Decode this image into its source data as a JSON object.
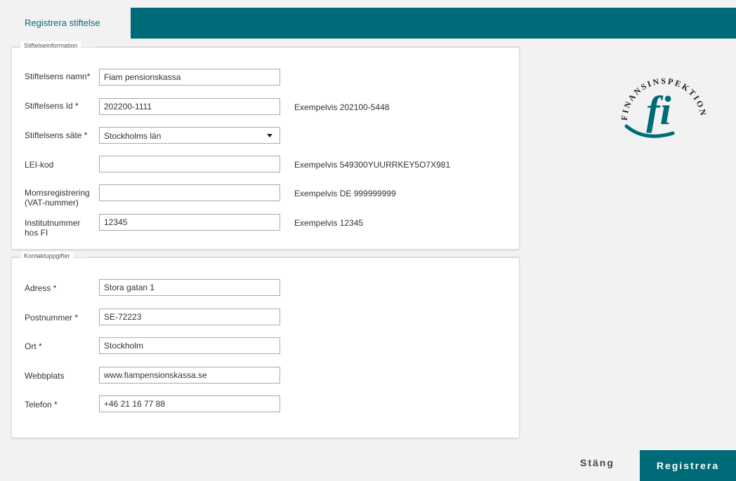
{
  "header": {
    "tab_label": "Registrera stiftelse"
  },
  "foundation_info": {
    "legend": "Stiftelseinformation",
    "name": {
      "label": "Stiftelsens namn*",
      "value": "Fiam pensionskassa"
    },
    "id": {
      "label": "Stiftelsens Id *",
      "value": "202200-1111",
      "hint": "Exempelvis 202100-5448"
    },
    "seat": {
      "label": "Stiftelsens säte *",
      "value": "Stockholms län"
    },
    "lei": {
      "label": "LEI-kod",
      "value": "",
      "hint": "Exempelvis 549300YUURRKEY5O7X981"
    },
    "vat": {
      "label": "Momsregistrering (VAT-nummer)",
      "value": "",
      "hint": "Exempelvis DE 999999999"
    },
    "institute": {
      "label": "Institutnummer hos FI",
      "value": "12345",
      "hint": "Exempelvis 12345"
    }
  },
  "contact_info": {
    "legend": "Kontaktuppgifter",
    "address": {
      "label": "Adress *",
      "value": "Stora gatan 1"
    },
    "postal": {
      "label": "Postnummer *",
      "value": "SE-72223"
    },
    "city": {
      "label": "Ort *",
      "value": "Stockholm"
    },
    "website": {
      "label": "Webbplats",
      "value": "www.fiampensionskassa.se"
    },
    "phone": {
      "label": "Telefon *",
      "value": "+46 21 16 77 88"
    }
  },
  "logo": {
    "text": "FINANSINSPEKTIONEN",
    "mark": "fi",
    "icon": "fi-logo-icon",
    "color": "#006b78"
  },
  "actions": {
    "close_label": "Stäng",
    "submit_label": "Registrera"
  },
  "colors": {
    "brand": "#006b78",
    "background": "#f2f2f2"
  }
}
